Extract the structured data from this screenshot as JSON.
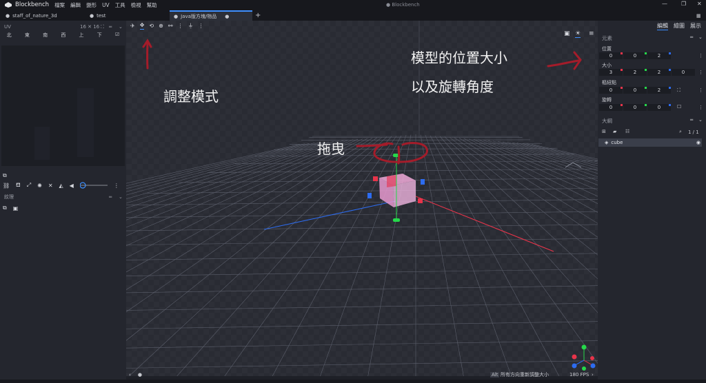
{
  "app": {
    "name": "Blockbench",
    "menu": [
      "檔案",
      "編輯",
      "變形",
      "UV",
      "工具",
      "檢視",
      "幫助"
    ],
    "window_title": "● Blockbench"
  },
  "tabs": [
    {
      "label": "staff_of_nature_3d"
    },
    {
      "label": "test"
    },
    {
      "label": "Java版方塊/物品",
      "modified_dot": "●"
    },
    {
      "label": "+"
    }
  ],
  "left_panel": {
    "uv_title": "UV",
    "uv_size": "16 ✕ 16",
    "faces": [
      "北",
      "東",
      "南",
      "西",
      "上",
      "下"
    ],
    "texture_title": "紋理"
  },
  "viewport": {
    "annotations": {
      "adjust_mode": "調整模式",
      "model_position": "模型的位置大小",
      "rotation": "以及旋轉角度",
      "drag": "拖曳"
    },
    "accent_color": "#a41c2a"
  },
  "right_panel": {
    "modes": [
      "編輯",
      "繪圖",
      "展示"
    ],
    "element_title": "元素",
    "position": {
      "label": "位置",
      "values": [
        "0",
        "0",
        "2"
      ]
    },
    "size": {
      "label": "大小",
      "values": [
        "3",
        "2",
        "2",
        "0"
      ]
    },
    "pivot": {
      "label": "樞紐點",
      "values": [
        "0",
        "0",
        "2"
      ]
    },
    "rotation": {
      "label": "旋轉",
      "values": [
        "0",
        "0",
        "0"
      ]
    },
    "outline_title": "大綱",
    "outline_count": "1 / 1",
    "outline_item": "cube"
  },
  "statusbar": {
    "alt_key": "Alt",
    "hint": "所有方向重新調整大小",
    "fps": "180 FPS"
  },
  "colors": {
    "x_axis": "#e8344a",
    "y_axis": "#25d84a",
    "z_axis": "#2d6cf0",
    "accent": "#3e90ff"
  }
}
